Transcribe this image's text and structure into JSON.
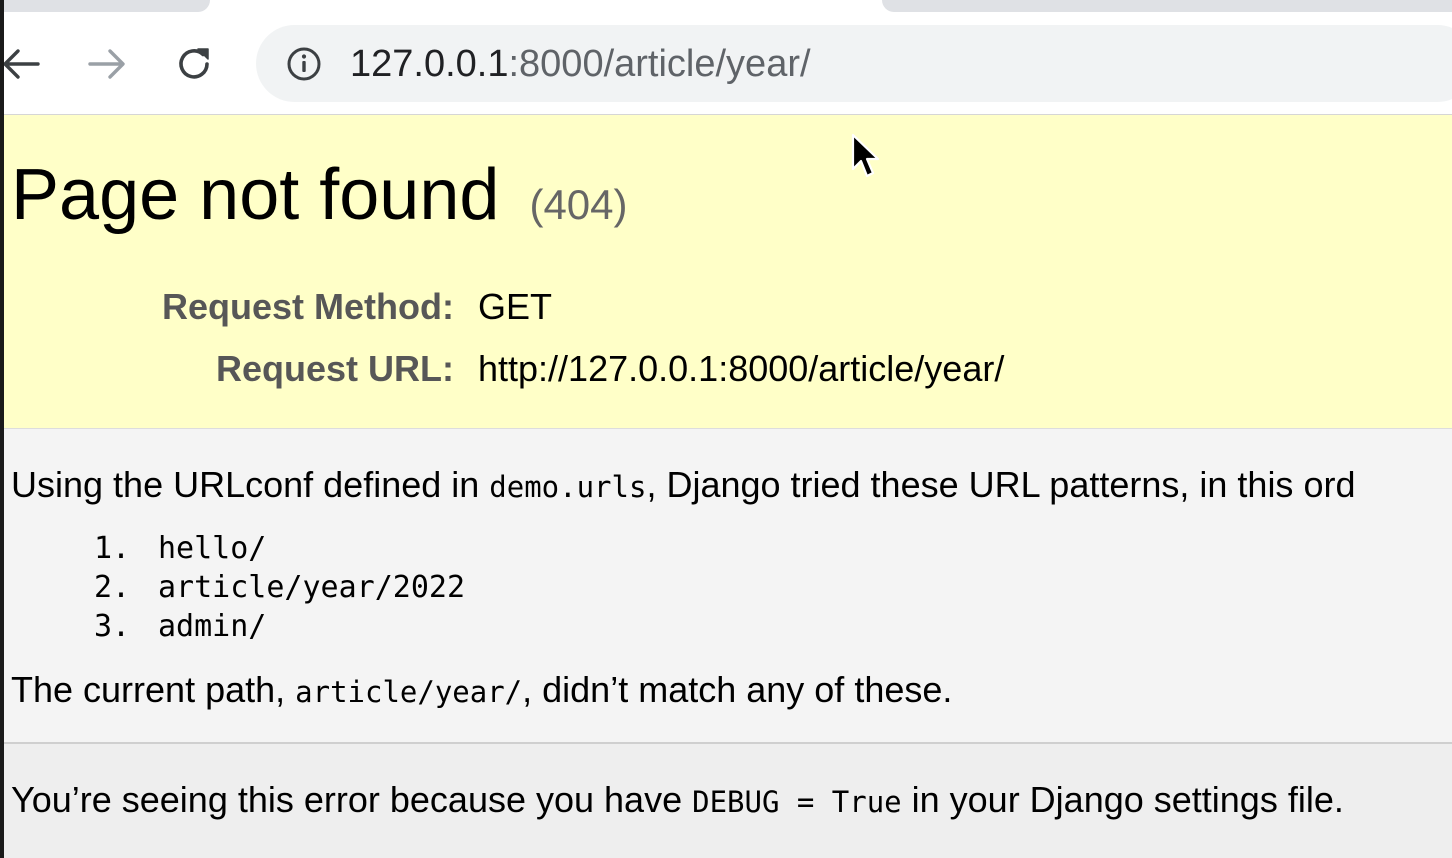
{
  "browser": {
    "address_bar": {
      "host": "127.0.0.1",
      "rest": ":8000/article/year/"
    },
    "icons": {
      "back": "arrow-left-icon",
      "forward": "arrow-right-icon",
      "reload": "reload-icon",
      "site_info": "info-circle-icon"
    }
  },
  "page": {
    "title": "Page not found",
    "status_code": "(404)",
    "request_method_label": "Request Method:",
    "request_method_value": "GET",
    "request_url_label": "Request URL:",
    "request_url_value": "http://127.0.0.1:8000/article/year/",
    "intro_before": "Using the URLconf defined in ",
    "intro_code": "demo.urls",
    "intro_after": ", Django tried these URL patterns, in this ord",
    "patterns": [
      {
        "num": "1.",
        "pattern": "hello/"
      },
      {
        "num": "2.",
        "pattern": "article/year/2022"
      },
      {
        "num": "3.",
        "pattern": "admin/"
      }
    ],
    "current_before": "The current path, ",
    "current_code": "article/year/",
    "current_after": ", didn’t match any of these.",
    "explanation_before": "You’re seeing this error because you have ",
    "explanation_code": "DEBUG = True",
    "explanation_after": " in your Django settings file."
  },
  "colors": {
    "summary_background": "#ffffc8",
    "info_background": "#f4f4f4",
    "label_color": "#575757"
  }
}
